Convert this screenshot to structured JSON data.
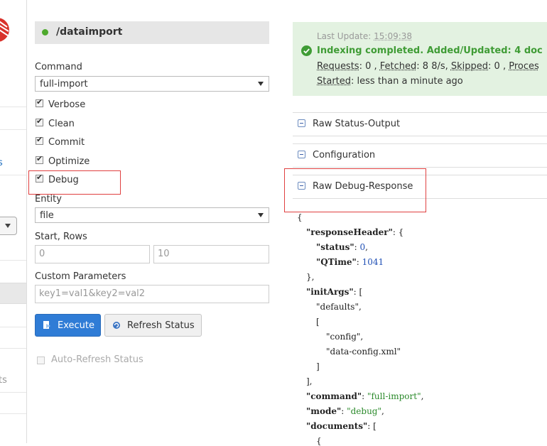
{
  "left_nav": {
    "fragment_1": "s",
    "fragment_2": "ts"
  },
  "panel": {
    "title": "/dataimport"
  },
  "command": {
    "label": "Command",
    "selected": "full-import"
  },
  "options": {
    "verbose": {
      "label": "Verbose",
      "checked": true
    },
    "clean": {
      "label": "Clean",
      "checked": true
    },
    "commit": {
      "label": "Commit",
      "checked": true
    },
    "optimize": {
      "label": "Optimize",
      "checked": true
    },
    "debug": {
      "label": "Debug",
      "checked": true
    }
  },
  "entity": {
    "label": "Entity",
    "selected": "file"
  },
  "start_rows": {
    "label": "Start, Rows",
    "start_placeholder": "0",
    "rows_placeholder": "10"
  },
  "custom": {
    "label": "Custom Parameters",
    "placeholder": "key1=val1&key2=val2"
  },
  "buttons": {
    "execute": "Execute",
    "refresh": "Refresh Status"
  },
  "auto_refresh": {
    "label": "Auto-Refresh Status",
    "checked": false
  },
  "status": {
    "last_update_label": "Last Update:",
    "last_update_time": "15:09:38",
    "message": "Indexing completed. Added/Updated: 4 doc",
    "requests_label": "Requests",
    "requests_value": ": 0 , ",
    "fetched_label": "Fetched",
    "fetched_value": ": 8 8/s, ",
    "skipped_label": "Skipped",
    "skipped_value": ": 0 , ",
    "processed_label": "Proces",
    "started_label": "Started",
    "started_value": ": less than a minute ago"
  },
  "sections": {
    "raw_status": "Raw Status-Output",
    "configuration": "Configuration",
    "raw_debug": "Raw Debug-Response"
  },
  "debug_json": {
    "l1": "{",
    "l2_key": "\"responseHeader\"",
    "l2_rest": ": {",
    "l3_key": "\"status\"",
    "l3_colon": ": ",
    "l3_val": "0",
    "l3_end": ",",
    "l4_key": "\"QTime\"",
    "l4_colon": ": ",
    "l4_val": "1041",
    "l5": "},",
    "l6_key": "\"initArgs\"",
    "l6_rest": ": [",
    "l7": "\"defaults\",",
    "l8": "[",
    "l9": "\"config\",",
    "l10": "\"data-config.xml\"",
    "l11": "]",
    "l12": "],",
    "l13_key": "\"command\"",
    "l13_colon": ": ",
    "l13_val": "\"full-import\"",
    "l13_end": ",",
    "l14_key": "\"mode\"",
    "l14_colon": ": ",
    "l14_val": "\"debug\"",
    "l14_end": ",",
    "l15_key": "\"documents\"",
    "l15_rest": ": [",
    "l16": "{"
  },
  "colors": {
    "accent_blue": "#2f7cd6",
    "success_green": "#3f9c35",
    "highlight_red": "#e04040"
  }
}
